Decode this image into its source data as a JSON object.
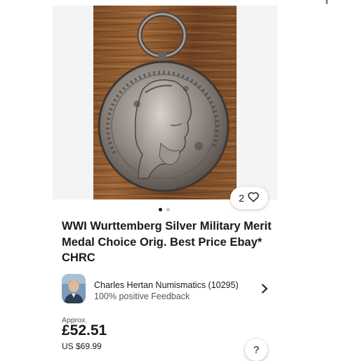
{
  "gallery": {
    "like_count": "2",
    "image_alt": "Silver medal with portrait of Wilhelm II of Wurttemberg",
    "dots": [
      {
        "active": true
      },
      {
        "active": false
      }
    ]
  },
  "listing": {
    "title": "WWI Wurttemberg Silver Military Merit Medal Choice Orig. Best Price Ebay* CHRC"
  },
  "seller": {
    "name": "Charles Hertan Numismatics (10295)",
    "feedback": "100% positive Feedback"
  },
  "price": {
    "approx_label": "Approx.",
    "gbp": "£52.51",
    "usd": "US $69.99"
  },
  "help": {
    "label": "?"
  },
  "icons": [
    "heart-icon",
    "chevron-right-icon",
    "help-icon"
  ],
  "colors": {
    "text": "#191919",
    "secondary": "#555555",
    "background": "#ffffff"
  }
}
